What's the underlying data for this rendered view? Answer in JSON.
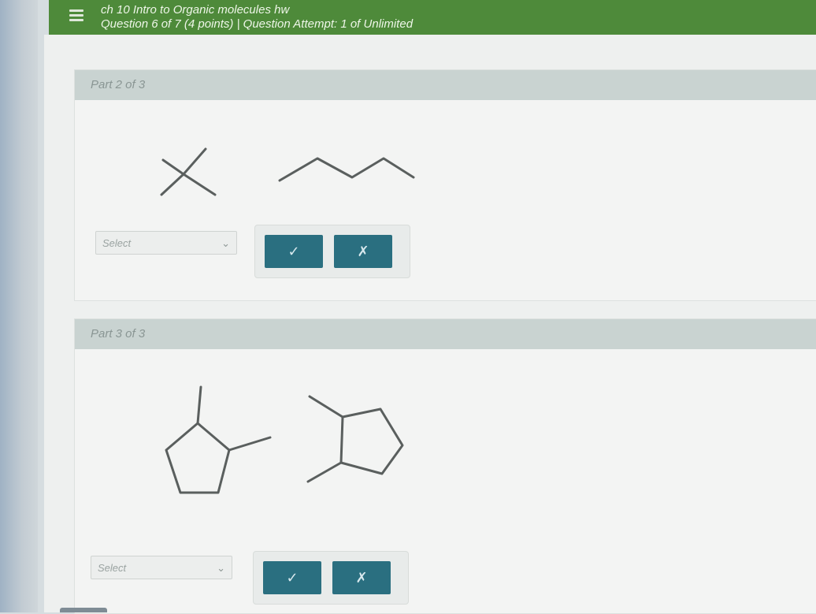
{
  "header": {
    "line1": "ch 10 Intro to Organic molecules hw",
    "line2": "Question 6 of 7 (4 points) | Question Attempt: 1 of Unlimited"
  },
  "parts": [
    {
      "label": "Part 2 of 3",
      "select_value": "Select",
      "check_button": "✓",
      "clear_button": "✗"
    },
    {
      "label": "Part 3 of 3",
      "select_value": "Select",
      "check_button": "✓",
      "clear_button": "✗"
    }
  ],
  "icons": {
    "menu": "hamburger-icon",
    "dropdown": "chevron-down-icon"
  },
  "colors": {
    "topbar": "#4e8a3a",
    "button": "#2a6f80",
    "part_header": "#c9d3d1"
  }
}
